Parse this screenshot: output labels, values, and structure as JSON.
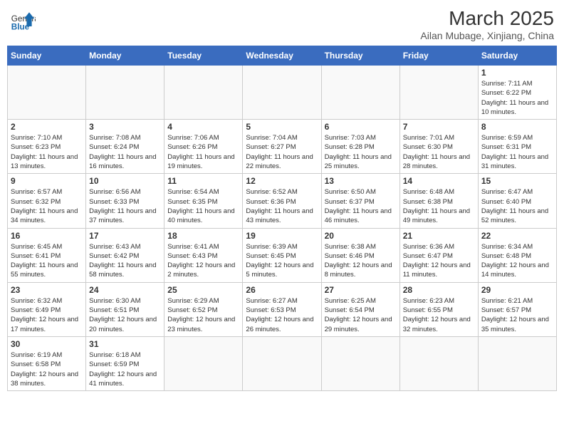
{
  "header": {
    "logo_general": "General",
    "logo_blue": "Blue",
    "month_year": "March 2025",
    "location": "Ailan Mubage, Xinjiang, China"
  },
  "weekdays": [
    "Sunday",
    "Monday",
    "Tuesday",
    "Wednesday",
    "Thursday",
    "Friday",
    "Saturday"
  ],
  "weeks": [
    [
      {
        "day": "",
        "info": ""
      },
      {
        "day": "",
        "info": ""
      },
      {
        "day": "",
        "info": ""
      },
      {
        "day": "",
        "info": ""
      },
      {
        "day": "",
        "info": ""
      },
      {
        "day": "",
        "info": ""
      },
      {
        "day": "1",
        "info": "Sunrise: 7:11 AM\nSunset: 6:22 PM\nDaylight: 11 hours and 10 minutes."
      }
    ],
    [
      {
        "day": "2",
        "info": "Sunrise: 7:10 AM\nSunset: 6:23 PM\nDaylight: 11 hours and 13 minutes."
      },
      {
        "day": "3",
        "info": "Sunrise: 7:08 AM\nSunset: 6:24 PM\nDaylight: 11 hours and 16 minutes."
      },
      {
        "day": "4",
        "info": "Sunrise: 7:06 AM\nSunset: 6:26 PM\nDaylight: 11 hours and 19 minutes."
      },
      {
        "day": "5",
        "info": "Sunrise: 7:04 AM\nSunset: 6:27 PM\nDaylight: 11 hours and 22 minutes."
      },
      {
        "day": "6",
        "info": "Sunrise: 7:03 AM\nSunset: 6:28 PM\nDaylight: 11 hours and 25 minutes."
      },
      {
        "day": "7",
        "info": "Sunrise: 7:01 AM\nSunset: 6:30 PM\nDaylight: 11 hours and 28 minutes."
      },
      {
        "day": "8",
        "info": "Sunrise: 6:59 AM\nSunset: 6:31 PM\nDaylight: 11 hours and 31 minutes."
      }
    ],
    [
      {
        "day": "9",
        "info": "Sunrise: 6:57 AM\nSunset: 6:32 PM\nDaylight: 11 hours and 34 minutes."
      },
      {
        "day": "10",
        "info": "Sunrise: 6:56 AM\nSunset: 6:33 PM\nDaylight: 11 hours and 37 minutes."
      },
      {
        "day": "11",
        "info": "Sunrise: 6:54 AM\nSunset: 6:35 PM\nDaylight: 11 hours and 40 minutes."
      },
      {
        "day": "12",
        "info": "Sunrise: 6:52 AM\nSunset: 6:36 PM\nDaylight: 11 hours and 43 minutes."
      },
      {
        "day": "13",
        "info": "Sunrise: 6:50 AM\nSunset: 6:37 PM\nDaylight: 11 hours and 46 minutes."
      },
      {
        "day": "14",
        "info": "Sunrise: 6:48 AM\nSunset: 6:38 PM\nDaylight: 11 hours and 49 minutes."
      },
      {
        "day": "15",
        "info": "Sunrise: 6:47 AM\nSunset: 6:40 PM\nDaylight: 11 hours and 52 minutes."
      }
    ],
    [
      {
        "day": "16",
        "info": "Sunrise: 6:45 AM\nSunset: 6:41 PM\nDaylight: 11 hours and 55 minutes."
      },
      {
        "day": "17",
        "info": "Sunrise: 6:43 AM\nSunset: 6:42 PM\nDaylight: 11 hours and 58 minutes."
      },
      {
        "day": "18",
        "info": "Sunrise: 6:41 AM\nSunset: 6:43 PM\nDaylight: 12 hours and 2 minutes."
      },
      {
        "day": "19",
        "info": "Sunrise: 6:39 AM\nSunset: 6:45 PM\nDaylight: 12 hours and 5 minutes."
      },
      {
        "day": "20",
        "info": "Sunrise: 6:38 AM\nSunset: 6:46 PM\nDaylight: 12 hours and 8 minutes."
      },
      {
        "day": "21",
        "info": "Sunrise: 6:36 AM\nSunset: 6:47 PM\nDaylight: 12 hours and 11 minutes."
      },
      {
        "day": "22",
        "info": "Sunrise: 6:34 AM\nSunset: 6:48 PM\nDaylight: 12 hours and 14 minutes."
      }
    ],
    [
      {
        "day": "23",
        "info": "Sunrise: 6:32 AM\nSunset: 6:49 PM\nDaylight: 12 hours and 17 minutes."
      },
      {
        "day": "24",
        "info": "Sunrise: 6:30 AM\nSunset: 6:51 PM\nDaylight: 12 hours and 20 minutes."
      },
      {
        "day": "25",
        "info": "Sunrise: 6:29 AM\nSunset: 6:52 PM\nDaylight: 12 hours and 23 minutes."
      },
      {
        "day": "26",
        "info": "Sunrise: 6:27 AM\nSunset: 6:53 PM\nDaylight: 12 hours and 26 minutes."
      },
      {
        "day": "27",
        "info": "Sunrise: 6:25 AM\nSunset: 6:54 PM\nDaylight: 12 hours and 29 minutes."
      },
      {
        "day": "28",
        "info": "Sunrise: 6:23 AM\nSunset: 6:55 PM\nDaylight: 12 hours and 32 minutes."
      },
      {
        "day": "29",
        "info": "Sunrise: 6:21 AM\nSunset: 6:57 PM\nDaylight: 12 hours and 35 minutes."
      }
    ],
    [
      {
        "day": "30",
        "info": "Sunrise: 6:19 AM\nSunset: 6:58 PM\nDaylight: 12 hours and 38 minutes."
      },
      {
        "day": "31",
        "info": "Sunrise: 6:18 AM\nSunset: 6:59 PM\nDaylight: 12 hours and 41 minutes."
      },
      {
        "day": "",
        "info": ""
      },
      {
        "day": "",
        "info": ""
      },
      {
        "day": "",
        "info": ""
      },
      {
        "day": "",
        "info": ""
      },
      {
        "day": "",
        "info": ""
      }
    ]
  ]
}
